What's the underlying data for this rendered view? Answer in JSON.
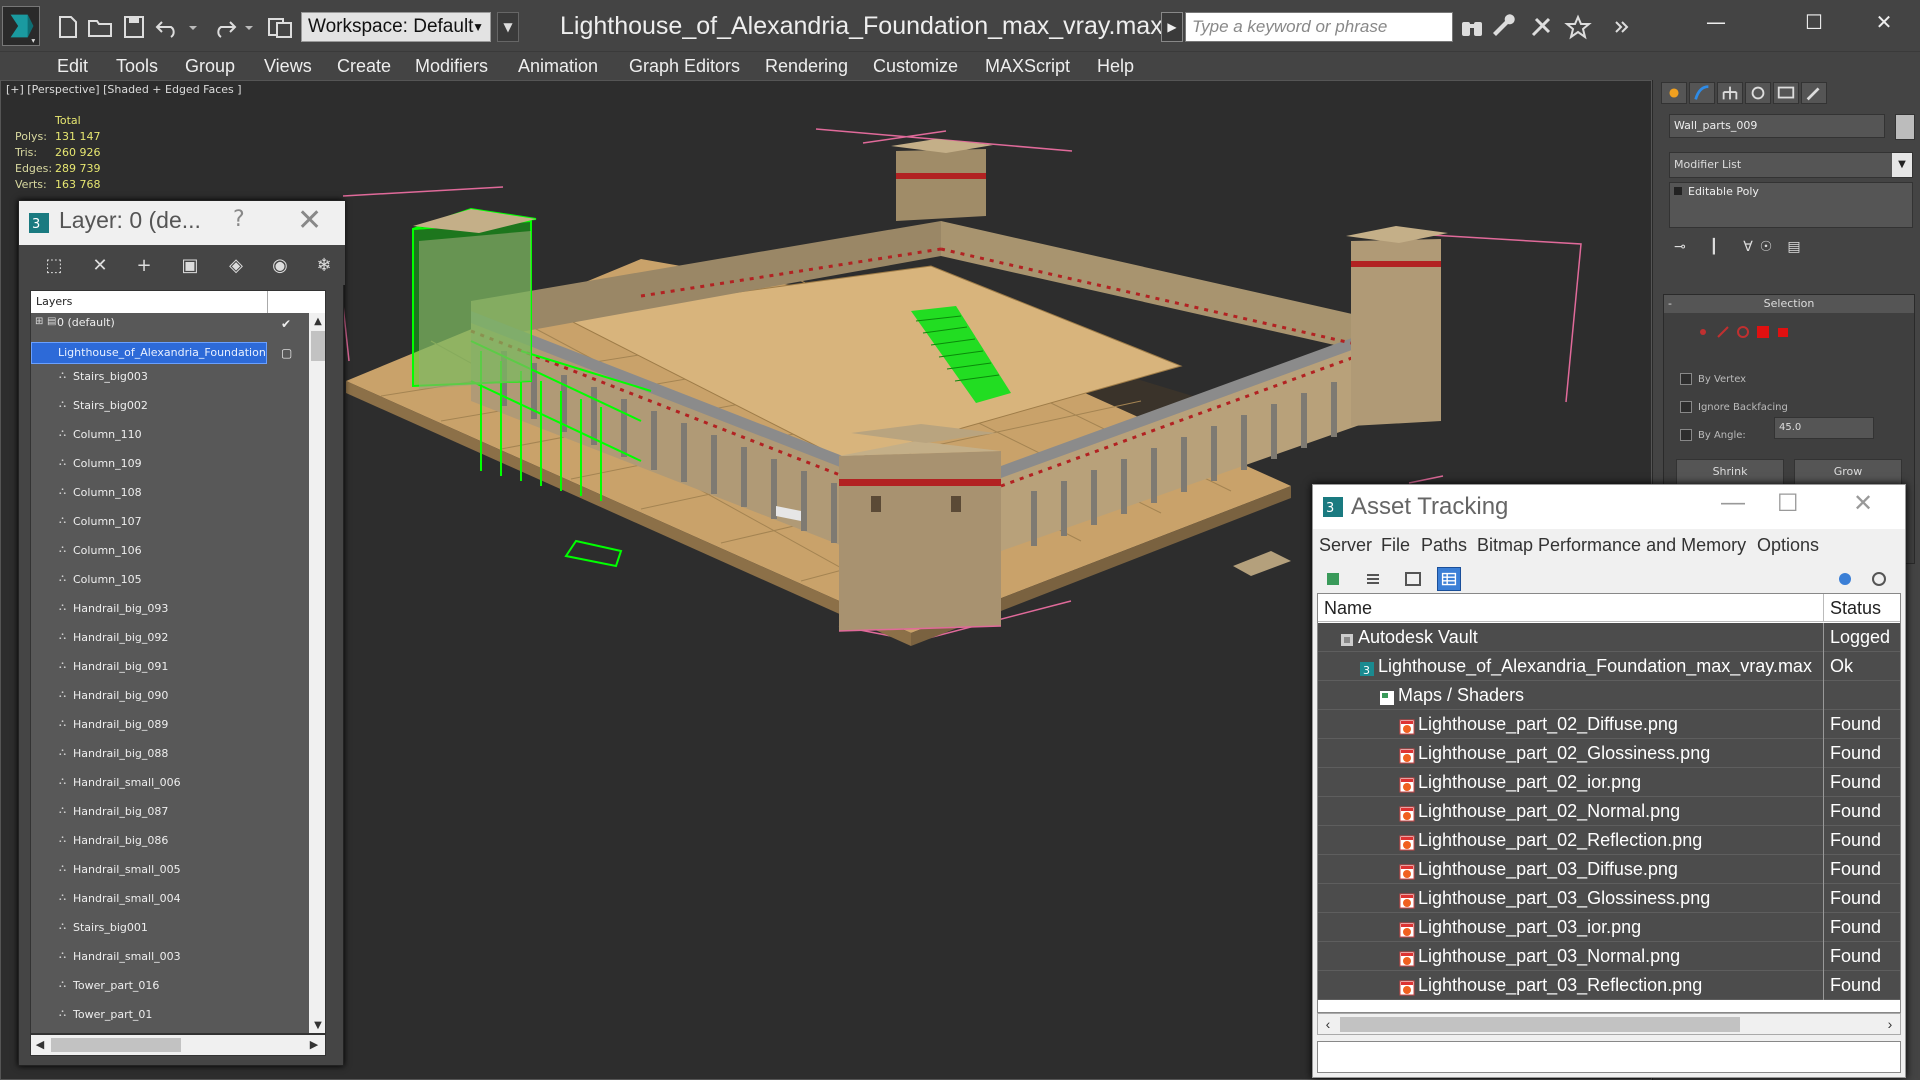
{
  "titlebar": {
    "workspace_label": "Workspace: Default",
    "document_title": "Lighthouse_of_Alexandria_Foundation_max_vray.max",
    "search_placeholder": "Type a keyword or phrase"
  },
  "menubar": {
    "items": [
      "Edit",
      "Tools",
      "Group",
      "Views",
      "Create",
      "Modifiers",
      "Animation",
      "Graph Editors",
      "Rendering",
      "Customize",
      "MAXScript",
      "Help"
    ]
  },
  "viewport": {
    "label": "[+] [Perspective] [Shaded + Edged Faces ]",
    "stats": {
      "header": "Total",
      "rows": [
        {
          "key": "Polys:",
          "value": "131 147"
        },
        {
          "key": "Tris:",
          "value": "260 926"
        },
        {
          "key": "Edges:",
          "value": "289 739"
        },
        {
          "key": "Verts:",
          "value": "163 768"
        }
      ]
    }
  },
  "layer_explorer": {
    "title": "Layer: 0 (de...",
    "help": "?",
    "column_header": "Layers",
    "layers": [
      {
        "name": "0 (default)",
        "checked": true
      },
      {
        "name": "Lighthouse_of_Alexandria_Foundation",
        "selected": true
      }
    ],
    "objects": [
      "Stairs_big003",
      "Stairs_big002",
      "Column_110",
      "Column_109",
      "Column_108",
      "Column_107",
      "Column_106",
      "Column_105",
      "Handrail_big_093",
      "Handrail_big_092",
      "Handrail_big_091",
      "Handrail_big_090",
      "Handrail_big_089",
      "Handrail_big_088",
      "Handrail_small_006",
      "Handrail_big_087",
      "Handrail_big_086",
      "Handrail_small_005",
      "Handrail_small_004",
      "Stairs_big001",
      "Handrail_small_003",
      "Tower_part_016",
      "Tower_part_01"
    ]
  },
  "command_panel": {
    "object_name": "Wall_parts_009",
    "modifier_list_label": "Modifier List",
    "stack_item": "Editable Poly",
    "selection_rollout": {
      "title": "Selection",
      "by_vertex": "By Vertex",
      "ignore_backfacing": "Ignore Backfacing",
      "by_angle": "By Angle:",
      "angle_value": "45.0",
      "shrink": "Shrink",
      "grow": "Grow"
    }
  },
  "asset_tracking": {
    "title": "Asset Tracking",
    "menu": [
      "Server",
      "File",
      "Paths",
      "Bitmap Performance and Memory",
      "Options"
    ],
    "columns": {
      "name": "Name",
      "status": "Status"
    },
    "rows": [
      {
        "name": "Autodesk Vault",
        "status": "Logged",
        "level": 0,
        "icon": "vault"
      },
      {
        "name": "Lighthouse_of_Alexandria_Foundation_max_vray.max",
        "status": "Ok",
        "level": 1,
        "icon": "max"
      },
      {
        "name": "Maps / Shaders",
        "status": "",
        "level": 2,
        "icon": "maps"
      },
      {
        "name": "Lighthouse_part_02_Diffuse.png",
        "status": "Found",
        "level": 3,
        "icon": "png"
      },
      {
        "name": "Lighthouse_part_02_Glossiness.png",
        "status": "Found",
        "level": 3,
        "icon": "png"
      },
      {
        "name": "Lighthouse_part_02_ior.png",
        "status": "Found",
        "level": 3,
        "icon": "png"
      },
      {
        "name": "Lighthouse_part_02_Normal.png",
        "status": "Found",
        "level": 3,
        "icon": "png"
      },
      {
        "name": "Lighthouse_part_02_Reflection.png",
        "status": "Found",
        "level": 3,
        "icon": "png"
      },
      {
        "name": "Lighthouse_part_03_Diffuse.png",
        "status": "Found",
        "level": 3,
        "icon": "png"
      },
      {
        "name": "Lighthouse_part_03_Glossiness.png",
        "status": "Found",
        "level": 3,
        "icon": "png"
      },
      {
        "name": "Lighthouse_part_03_ior.png",
        "status": "Found",
        "level": 3,
        "icon": "png"
      },
      {
        "name": "Lighthouse_part_03_Normal.png",
        "status": "Found",
        "level": 3,
        "icon": "png"
      },
      {
        "name": "Lighthouse_part_03_Reflection.png",
        "status": "Found",
        "level": 3,
        "icon": "png"
      }
    ]
  },
  "colors": {
    "ui_background": "#444444",
    "viewport_background": "#2d2d2d",
    "selection_blue": "#2d6ad8",
    "selected_geometry_green": "#00ff00",
    "stone": "#b09a76",
    "floor_tile": "#d8b47c",
    "stats_yellow": "#e6e670"
  }
}
